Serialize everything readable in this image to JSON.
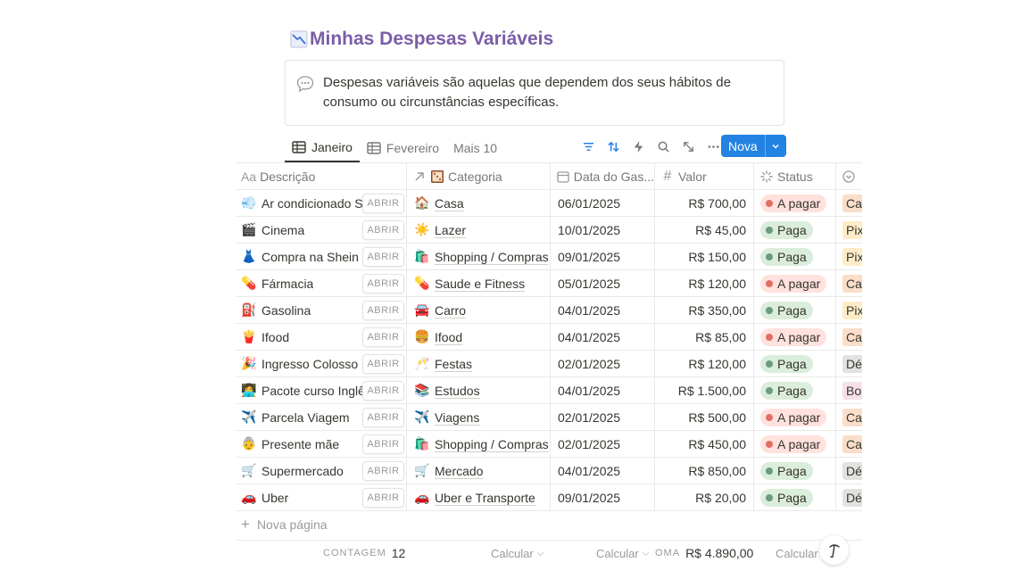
{
  "page": {
    "title": "Minhas Despesas Variáveis",
    "title_icon": "chart-decreasing-icon"
  },
  "callout": {
    "icon": "speech-bubble-icon",
    "text": "Despesas variáveis são aquelas que dependem dos seus hábitos de consumo ou circunstâncias específicas."
  },
  "tabs": [
    {
      "label": "Janeiro",
      "icon": "table-icon",
      "active": true
    },
    {
      "label": "Fevereiro",
      "icon": "table-icon",
      "active": false
    },
    {
      "label": "Mais 10"
    }
  ],
  "toolbar": {
    "new_label": "Nova"
  },
  "columns": {
    "descricao": "Descrição",
    "descricao_prefix": "Aa",
    "categoria": "Categoria",
    "data": "Data do Gas...",
    "valor": "Valor",
    "status": "Status"
  },
  "open_label": "ABRIR",
  "colors": {
    "title": "#7b5ea7",
    "accent": "#2383e2",
    "paga_bg": "#dbeddb",
    "paga_dot": "#6c9b7d",
    "apagar_bg": "#ffe2dd",
    "apagar_dot": "#e16f64"
  },
  "rows": [
    {
      "emoji": "💨",
      "descricao": "Ar condicionado Sa",
      "cat_emoji": "🏠",
      "categoria": "Casa",
      "data": "06/01/2025",
      "valor": "R$ 700,00",
      "status": "A pagar",
      "pagamento": "Ca"
    },
    {
      "emoji": "🎬",
      "descricao": "Cinema",
      "cat_emoji": "☀️",
      "categoria": "Lazer",
      "data": "10/01/2025",
      "valor": "R$ 45,00",
      "status": "Paga",
      "pagamento": "Pix"
    },
    {
      "emoji": "👗",
      "descricao": "Compra na Shein",
      "cat_emoji": "🛍️",
      "categoria": "Shopping / Compras",
      "data": "09/01/2025",
      "valor": "R$ 150,00",
      "status": "Paga",
      "pagamento": "Pix"
    },
    {
      "emoji": "💊",
      "descricao": "Fármacia",
      "cat_emoji": "💊",
      "categoria": "Saude e Fitness",
      "data": "05/01/2025",
      "valor": "R$ 120,00",
      "status": "A pagar",
      "pagamento": "Ca"
    },
    {
      "emoji": "⛽",
      "descricao": "Gasolina",
      "cat_emoji": "🚘",
      "categoria": "Carro",
      "data": "04/01/2025",
      "valor": "R$ 350,00",
      "status": "Paga",
      "pagamento": "Pix"
    },
    {
      "emoji": "🍟",
      "descricao": "Ifood",
      "cat_emoji": "🍔",
      "categoria": "Ifood",
      "data": "04/01/2025",
      "valor": "R$ 85,00",
      "status": "A pagar",
      "pagamento": "Ca"
    },
    {
      "emoji": "🎉",
      "descricao": "Ingresso Colosso",
      "cat_emoji": "🥂",
      "categoria": "Festas",
      "data": "02/01/2025",
      "valor": "R$ 120,00",
      "status": "Paga",
      "pagamento": "Dé"
    },
    {
      "emoji": "👩‍💻",
      "descricao": "Pacote curso Inglês",
      "cat_emoji": "📚",
      "categoria": "Estudos",
      "data": "04/01/2025",
      "valor": "R$ 1.500,00",
      "status": "Paga",
      "pagamento": "Bo"
    },
    {
      "emoji": "✈️",
      "descricao": "Parcela Viagem",
      "cat_emoji": "✈️",
      "categoria": "Viagens",
      "data": "02/01/2025",
      "valor": "R$ 500,00",
      "status": "A pagar",
      "pagamento": "Ca"
    },
    {
      "emoji": "👵",
      "descricao": "Presente mãe",
      "cat_emoji": "🛍️",
      "categoria": "Shopping / Compras",
      "data": "02/01/2025",
      "valor": "R$ 450,00",
      "status": "A pagar",
      "pagamento": "Ca"
    },
    {
      "emoji": "🛒",
      "descricao": "Supermercado",
      "cat_emoji": "🛒",
      "categoria": "Mercado",
      "data": "04/01/2025",
      "valor": "R$ 850,00",
      "status": "Paga",
      "pagamento": "Dé"
    },
    {
      "emoji": "🚗",
      "descricao": "Uber",
      "cat_emoji": "🚗",
      "categoria": "Uber e Transporte",
      "data": "09/01/2025",
      "valor": "R$ 20,00",
      "status": "Paga",
      "pagamento": "Dé"
    }
  ],
  "new_page_label": "Nova página",
  "footer": {
    "count_label": "CONTAGEM",
    "count_value": "12",
    "calc_label": "Calcular",
    "sum_label": "OMA",
    "sum_value": "R$ 4.890,00"
  }
}
